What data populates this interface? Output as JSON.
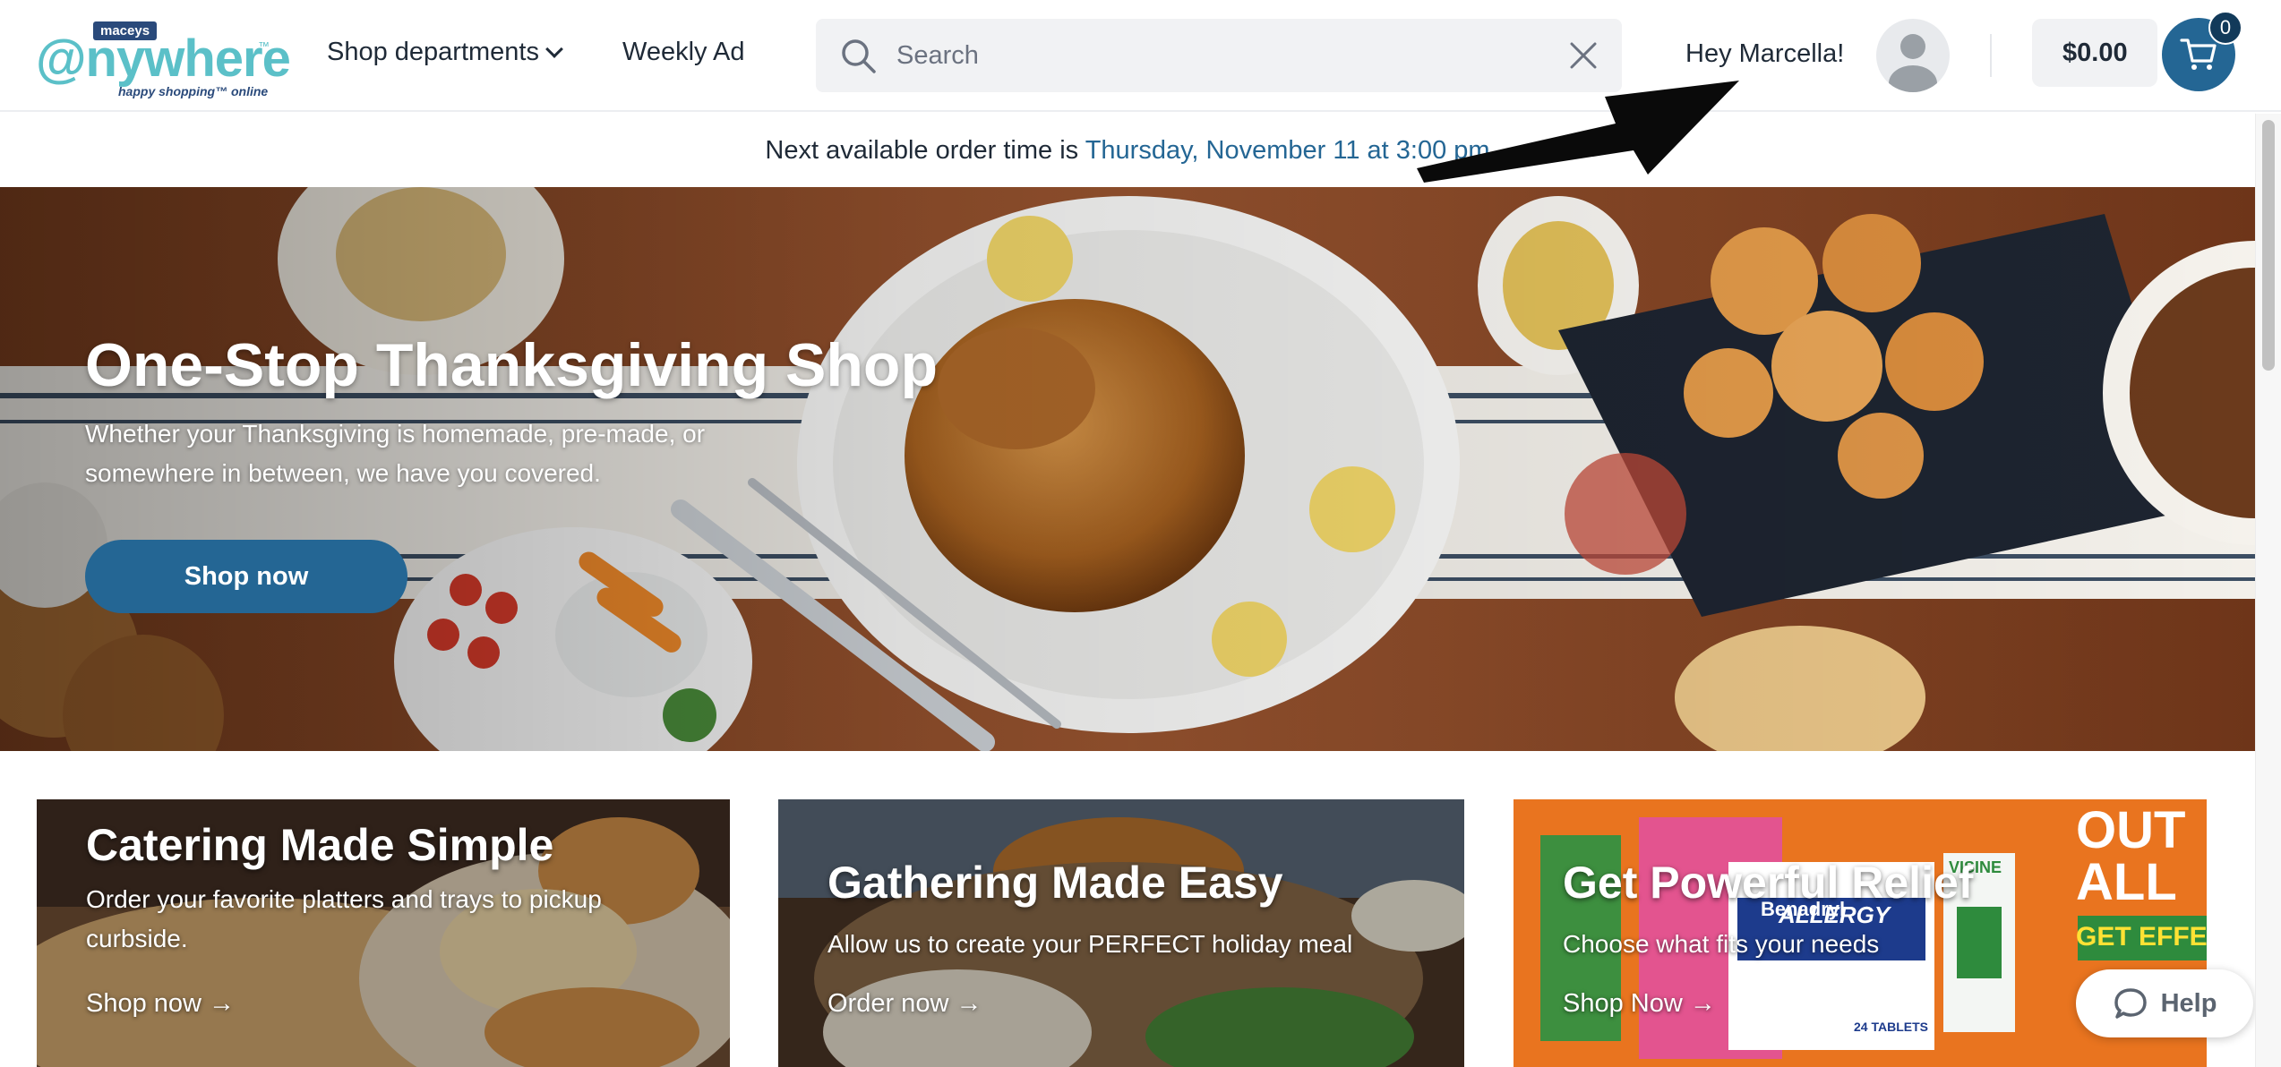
{
  "logo": {
    "tag": "maceys",
    "word": "@nywhere",
    "tagline": "happy shopping™ online",
    "tm": "™"
  },
  "nav": {
    "shop_departments": "Shop departments",
    "weekly_ad": "Weekly Ad"
  },
  "search": {
    "placeholder": "Search",
    "value": ""
  },
  "user": {
    "greeting": "Hey Marcella!"
  },
  "cart": {
    "total": "$0.00",
    "count": "0"
  },
  "notice": {
    "prefix": "Next available order time is ",
    "time": "Thursday, November 11 at 3:00 pm"
  },
  "hero": {
    "title": "One-Stop Thanksgiving Shop",
    "subtitle": "Whether your Thanksgiving is homemade, pre-made, or somewhere in between, we have you covered.",
    "button": "Shop now"
  },
  "cards": [
    {
      "title": "Catering Made Simple",
      "subtitle": "Order your favorite platters and trays to pickup curbside.",
      "link": "Shop now →"
    },
    {
      "title": "Gathering Made Easy",
      "subtitle": "Allow us to create your PERFECT holiday meal",
      "link": "Order now →"
    },
    {
      "title": "Get Powerful Relief",
      "subtitle": "Choose what fits your needs",
      "link": "Shop Now →"
    }
  ],
  "promo_brand": {
    "benadryl": "Benadryl",
    "allergy": "ALLERGY",
    "visine": "VISINE",
    "out": "OUT",
    "all": "ALL",
    "get_effect": "GET EFFE",
    "tablets": "24 TABLETS"
  },
  "help": {
    "label": "Help"
  },
  "colors": {
    "primary": "#246694",
    "logo_teal": "#5bc0c8",
    "promo_orange": "#e9741f",
    "promo_green": "#2e8b3d"
  }
}
